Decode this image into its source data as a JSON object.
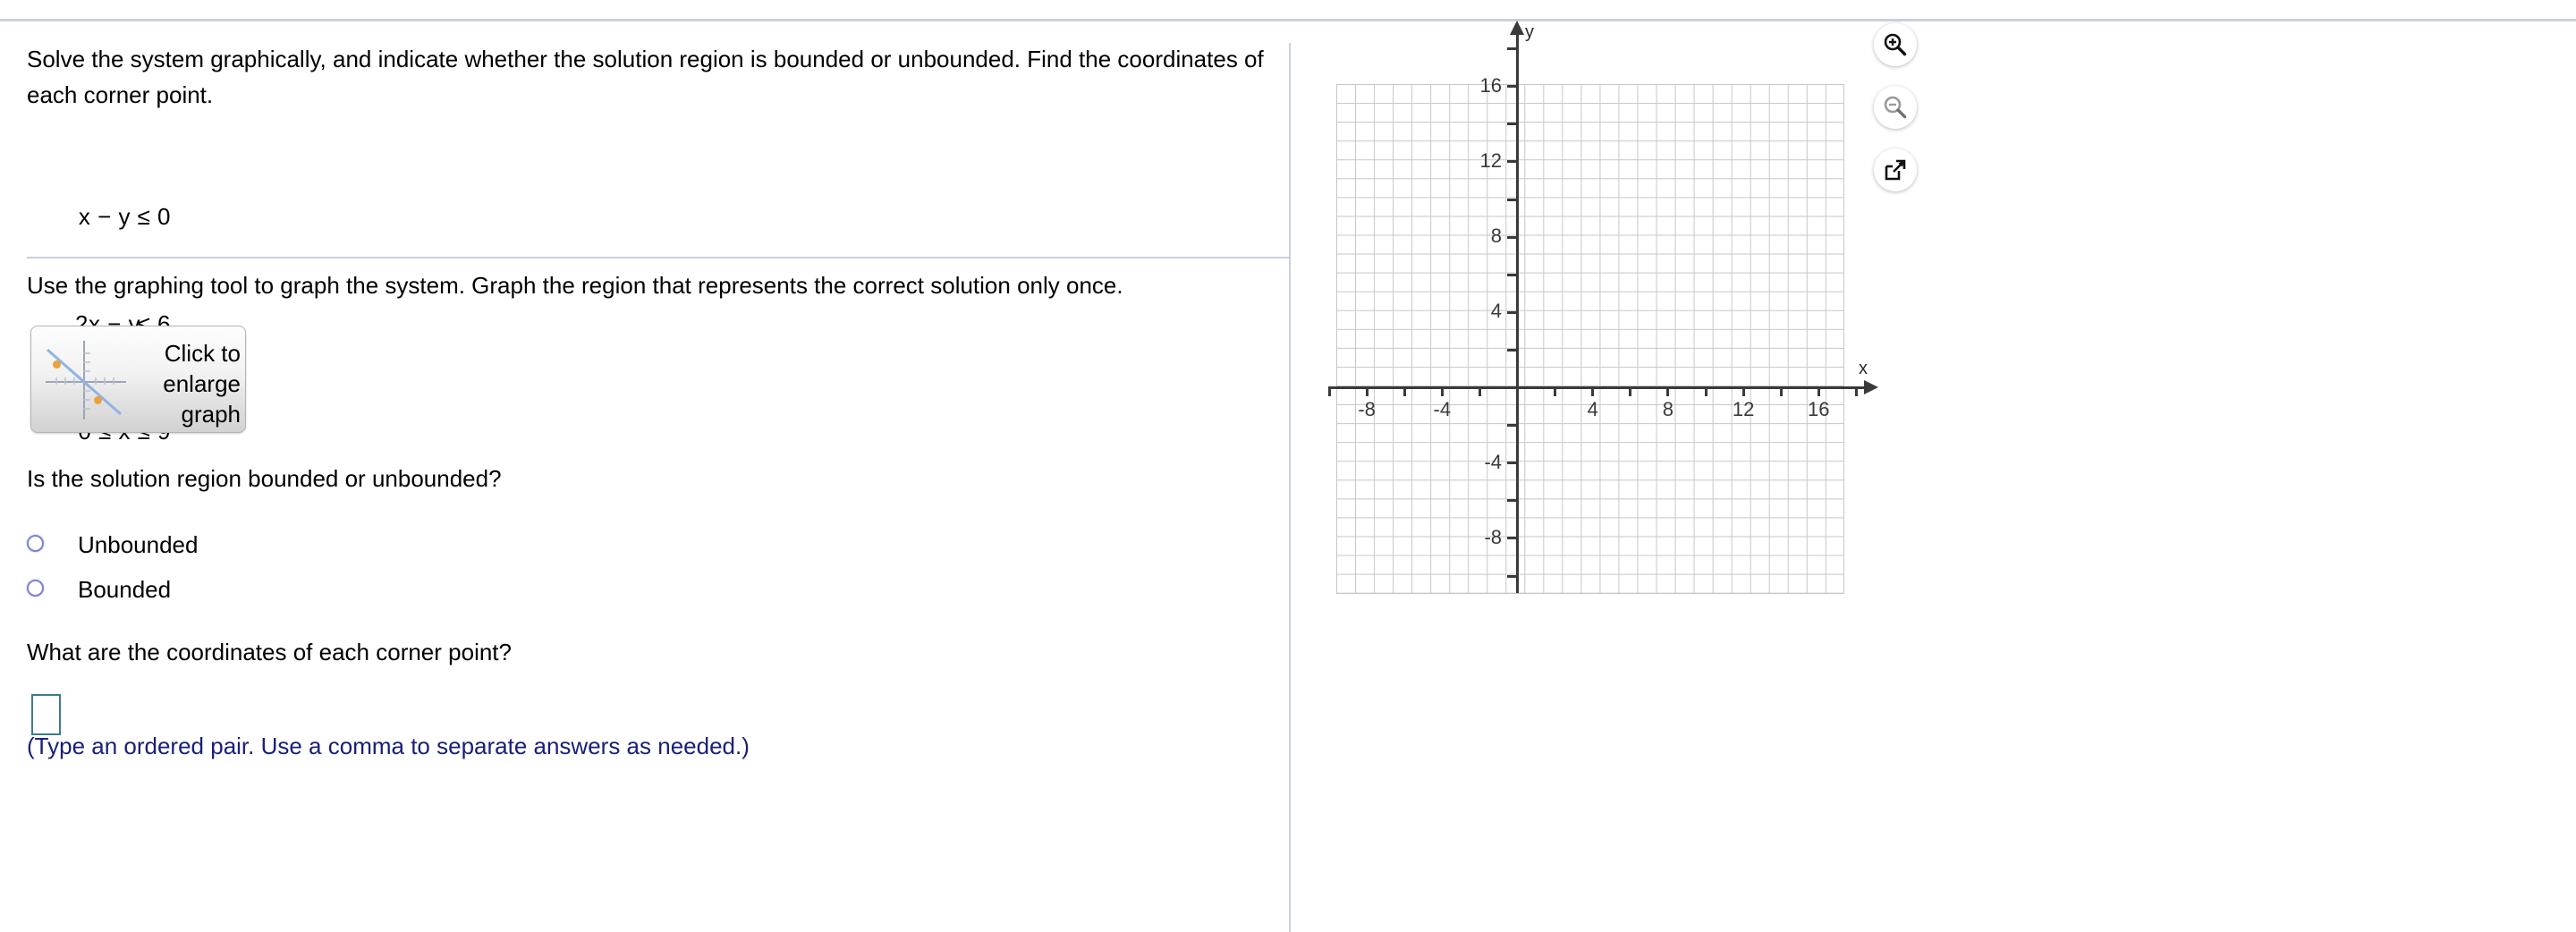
{
  "problem": {
    "statement": "Solve the system graphically, and indicate whether the solution region is bounded or unbounded. Find the coordinates of each corner point.",
    "system": [
      {
        "lhs": "x − y",
        "rel": "≤",
        "rhs": "0"
      },
      {
        "lhs": "2x − y",
        "rel": "≤",
        "rhs": "6"
      },
      {
        "lhs": "0 ≤ x",
        "rel": "≤",
        "rhs": "9"
      }
    ],
    "instruction": "Use the graphing tool to graph the system. Graph the region that represents the correct solution only once.",
    "enlarge_button_label": "Click to enlarge graph",
    "bounded_question": "Is the solution region bounded or unbounded?",
    "choices": [
      {
        "label": "Unbounded",
        "selected": false
      },
      {
        "label": "Bounded",
        "selected": false
      }
    ],
    "corner_question": "What are the coordinates of each corner point?",
    "answer_value": "",
    "answer_placeholder": "",
    "answer_hint": "(Type an ordered pair. Use a comma to separate answers as needed.)"
  },
  "graph": {
    "x_axis_label": "x",
    "y_axis_label": "y",
    "x_tick_labels": [
      "-8",
      "-4",
      "4",
      "8",
      "12",
      "16"
    ],
    "y_tick_labels": [
      "16",
      "12",
      "8",
      "4",
      "-4",
      "-8"
    ],
    "tools": [
      {
        "name": "zoom-in",
        "enabled": true
      },
      {
        "name": "zoom-out",
        "enabled": false
      },
      {
        "name": "open-in-new-window",
        "enabled": true
      }
    ]
  },
  "chart_data": {
    "type": "scatter",
    "title": "",
    "xlabel": "x",
    "ylabel": "y",
    "xlim": [
      -10,
      18
    ],
    "ylim": [
      -10,
      18
    ],
    "xticks": [
      -8,
      -4,
      4,
      8,
      12,
      16
    ],
    "yticks": [
      16,
      12,
      8,
      4,
      -4,
      -8
    ],
    "grid": true,
    "grid_step": 1,
    "major_tick_step": 2,
    "series": [],
    "annotations": []
  },
  "colors": {
    "divider": "#c9cfdf",
    "grid": "#c6c6c6",
    "axis": "#3a3a3a",
    "radio": "#7b82d6",
    "input_border": "#3d7c8a",
    "hint_text": "#18207a",
    "thumb_dot": "#eda13a",
    "thumb_line": "#8fb4e3"
  }
}
